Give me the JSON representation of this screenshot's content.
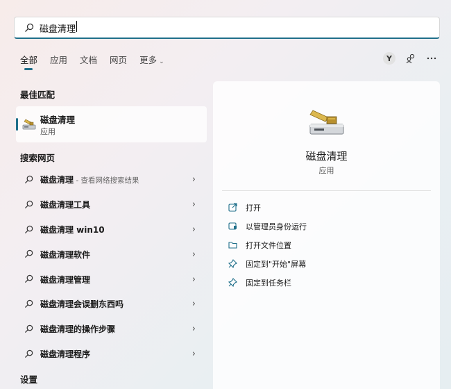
{
  "search": {
    "value": "磁盘清理",
    "placeholder": ""
  },
  "tabs": [
    {
      "label": "全部",
      "active": true
    },
    {
      "label": "应用",
      "active": false
    },
    {
      "label": "文档",
      "active": false
    },
    {
      "label": "网页",
      "active": false
    },
    {
      "label": "更多",
      "active": false,
      "dropdown": true
    }
  ],
  "account": {
    "initial": "Y"
  },
  "best_match": {
    "title": "最佳匹配",
    "name": "磁盘清理",
    "type": "应用"
  },
  "web_section_title": "搜索网页",
  "web_results": [
    {
      "text": "磁盘清理",
      "suffix": " - 查看网络搜索结果"
    },
    {
      "text": "磁盘清理工具",
      "suffix": ""
    },
    {
      "text": "磁盘清理 win10",
      "suffix": ""
    },
    {
      "text": "磁盘清理软件",
      "suffix": ""
    },
    {
      "text": "磁盘清理管理",
      "suffix": ""
    },
    {
      "text": "磁盘清理会误删东西吗",
      "suffix": ""
    },
    {
      "text": "磁盘清理的操作步骤",
      "suffix": ""
    },
    {
      "text": "磁盘清理程序",
      "suffix": ""
    }
  ],
  "settings_section_title": "设置",
  "detail": {
    "name": "磁盘清理",
    "type": "应用",
    "actions": [
      {
        "label": "打开",
        "icon": "open-external-icon"
      },
      {
        "label": "以管理员身份运行",
        "icon": "shield-admin-icon"
      },
      {
        "label": "打开文件位置",
        "icon": "folder-icon"
      },
      {
        "label": "固定到\"开始\"屏幕",
        "icon": "pin-icon"
      },
      {
        "label": "固定到任务栏",
        "icon": "pin-icon"
      }
    ]
  },
  "colors": {
    "accent": "#1f6f8a"
  }
}
